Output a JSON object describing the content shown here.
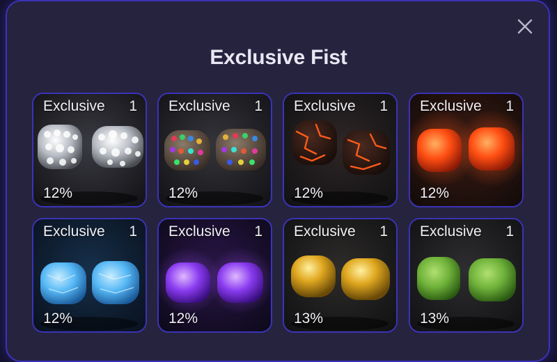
{
  "modal": {
    "title": "Exclusive Fist",
    "close_icon": "close-icon"
  },
  "items": [
    {
      "label": "Exclusive",
      "count": "1",
      "chance": "12%",
      "icon": "diamond-fist-icon",
      "color": "#d9dde3"
    },
    {
      "label": "Exclusive",
      "count": "1",
      "chance": "12%",
      "icon": "gem-fist-icon",
      "color": "#7a5a48"
    },
    {
      "label": "Exclusive",
      "count": "1",
      "chance": "12%",
      "icon": "lava-fist-icon",
      "color": "#ff5a1a"
    },
    {
      "label": "Exclusive",
      "count": "1",
      "chance": "12%",
      "icon": "fire-fist-icon",
      "color": "#ff4d12"
    },
    {
      "label": "Exclusive",
      "count": "1",
      "chance": "12%",
      "icon": "ice-fist-icon",
      "color": "#56b8f5"
    },
    {
      "label": "Exclusive",
      "count": "1",
      "chance": "12%",
      "icon": "void-fist-icon",
      "color": "#8a3cf0"
    },
    {
      "label": "Exclusive",
      "count": "1",
      "chance": "13%",
      "icon": "gold-fist-icon",
      "color": "#e0a820"
    },
    {
      "label": "Exclusive",
      "count": "1",
      "chance": "13%",
      "icon": "grass-fist-icon",
      "color": "#6fb23a"
    }
  ]
}
